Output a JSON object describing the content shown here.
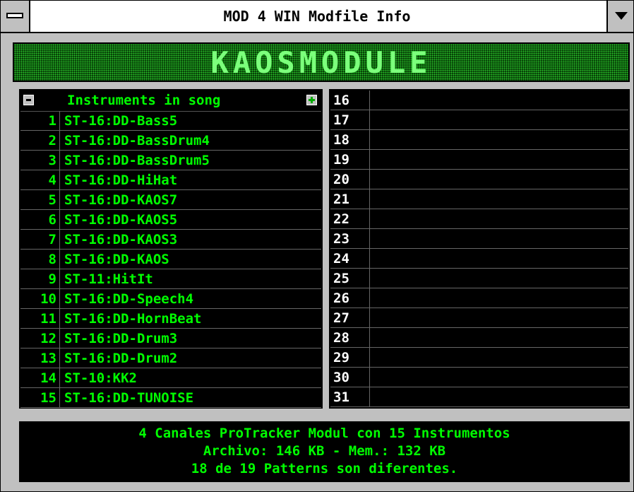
{
  "window": {
    "title": "MOD 4 WIN Modfile Info"
  },
  "banner": {
    "text": "KAOSMODULE"
  },
  "instruments": {
    "header": "Instruments in song",
    "items": [
      {
        "num": "1",
        "name": "ST-16:DD-Bass5"
      },
      {
        "num": "2",
        "name": "ST-16:DD-BassDrum4"
      },
      {
        "num": "3",
        "name": "ST-16:DD-BassDrum5"
      },
      {
        "num": "4",
        "name": "ST-16:DD-HiHat"
      },
      {
        "num": "5",
        "name": "ST-16:DD-KAOS7"
      },
      {
        "num": "6",
        "name": "ST-16:DD-KAOS5"
      },
      {
        "num": "7",
        "name": "ST-16:DD-KAOS3"
      },
      {
        "num": "8",
        "name": "ST-16:DD-KAOS"
      },
      {
        "num": "9",
        "name": "ST-11:HitIt"
      },
      {
        "num": "10",
        "name": "ST-16:DD-Speech4"
      },
      {
        "num": "11",
        "name": "ST-16:DD-HornBeat"
      },
      {
        "num": "12",
        "name": "ST-16:DD-Drum3"
      },
      {
        "num": "13",
        "name": "ST-16:DD-Drum2"
      },
      {
        "num": "14",
        "name": "ST-10:KK2"
      },
      {
        "num": "15",
        "name": "ST-16:DD-TUNOISE"
      }
    ],
    "right_numbers": [
      "16",
      "17",
      "18",
      "19",
      "20",
      "21",
      "22",
      "23",
      "24",
      "25",
      "26",
      "27",
      "28",
      "29",
      "30",
      "31"
    ]
  },
  "info": {
    "line1": "4 Canales ProTracker Modul con 15 Instrumentos",
    "line2": "Archivo: 146 KB - Mem.: 132 KB",
    "line3": "18 de 19 Patterns son diferentes."
  },
  "colors": {
    "text_green": "#00ff00",
    "background_black": "#000000",
    "frame_gray": "#c0c0c0"
  }
}
